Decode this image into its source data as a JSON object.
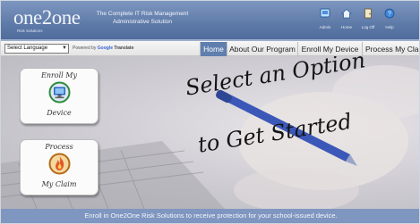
{
  "header": {
    "logo": {
      "brand": "one2one",
      "sub": "Risk Solutions"
    },
    "tagline": [
      "The Complete IT Risk Management",
      "Administrative Solution"
    ],
    "quicknav": [
      {
        "label": "Admin",
        "icon": "admin-icon"
      },
      {
        "label": "Home",
        "icon": "home-icon"
      },
      {
        "label": "Log Off",
        "icon": "log-off-icon"
      },
      {
        "label": "Help",
        "icon": "help-icon"
      }
    ]
  },
  "menubar": {
    "language_select": "Select Language",
    "powered_prefix": "Powered by",
    "powered_google": "Google",
    "powered_translate": "Translate",
    "tabs": [
      "Home",
      "About Our Program",
      "Enroll My Device",
      "Process My Claim"
    ],
    "active_tab": "Home"
  },
  "hero": {
    "enroll_card": {
      "top": "Enroll My",
      "bottom": "Device",
      "icon": "computer-icon"
    },
    "process_card": {
      "top": "Process",
      "bottom": "My Claim",
      "icon": "flame-icon"
    },
    "headline_1": "Select an Option",
    "headline_2": "to Get Started"
  },
  "footer": {
    "text": "Enroll in One2One Risk Solutions to receive protection for your school-issued device."
  },
  "colors": {
    "header": "#5e7aa8",
    "active_tab": "#5f7fae",
    "footer": "#7f96c0"
  }
}
